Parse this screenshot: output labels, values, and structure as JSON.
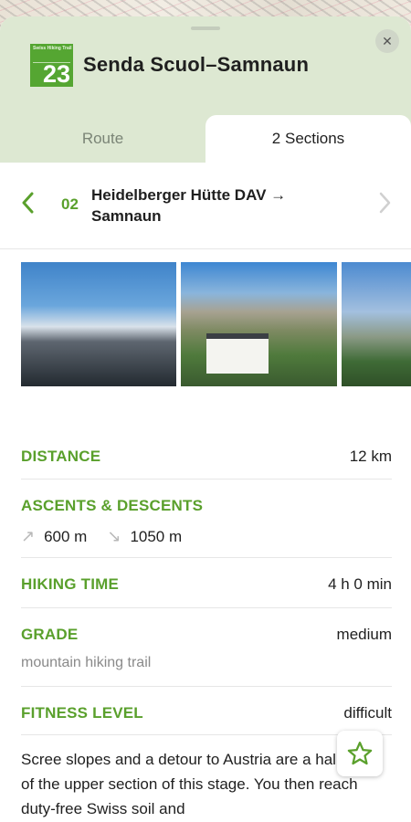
{
  "route": {
    "logo": {
      "small_text": "Swiss Hiking Trail",
      "number": "23"
    },
    "title": "Senda Scuol–Samnaun"
  },
  "tabs": [
    {
      "label": "Route",
      "selected": false
    },
    {
      "label": "2 Sections",
      "selected": true
    }
  ],
  "section": {
    "number": "02",
    "title": "Heidelberger Hütte DAV → Samnaun"
  },
  "photos": [
    "Mountain clouds",
    "Heidelberger Hütte",
    "Valley road"
  ],
  "details": {
    "distance": {
      "label": "DISTANCE",
      "value": "12 km"
    },
    "ascents": {
      "label": "ASCENTS & DESCENTS",
      "up": "600 m",
      "down": "1050 m"
    },
    "hiking_time": {
      "label": "HIKING TIME",
      "value": "4 h 0 min"
    },
    "grade": {
      "label": "GRADE",
      "value": "medium",
      "sub": "mountain hiking trail"
    },
    "fitness": {
      "label": "FITNESS LEVEL",
      "value": "difficult"
    }
  },
  "description": "Scree slopes and a detour to Austria are a hallmark of the upper section of this stage. You then reach duty-free Swiss soil and",
  "icons": {
    "close": "close-icon",
    "prev": "chevron-left-icon",
    "next": "chevron-right-icon",
    "ascent": "arrow-up-right-icon",
    "descent": "arrow-down-right-icon",
    "favorite": "star-icon"
  },
  "colors": {
    "accent": "#5aa02c",
    "header_bg": "#dde8d2"
  }
}
